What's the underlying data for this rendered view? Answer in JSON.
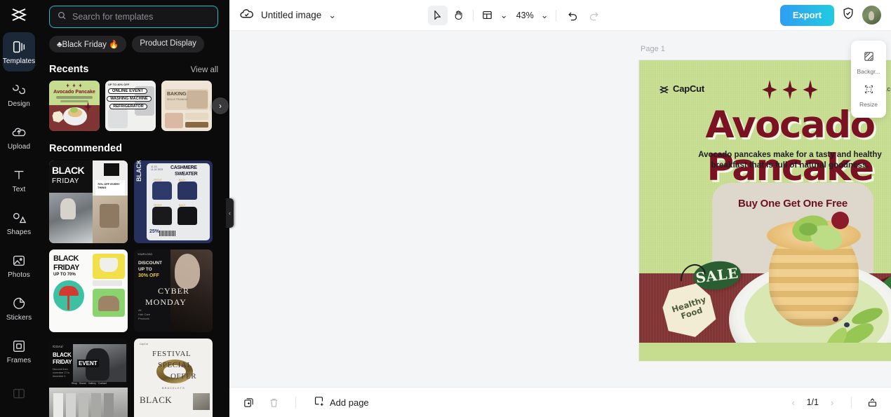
{
  "app": {
    "name": "CapCut Online Editor"
  },
  "sidebar_rail": {
    "logo_name": "capcut-logo",
    "items": [
      {
        "label": "Templates",
        "icon": "templates-icon",
        "active": true
      },
      {
        "label": "Design",
        "icon": "design-icon",
        "active": false
      },
      {
        "label": "Upload",
        "icon": "upload-cloud-icon",
        "active": false
      },
      {
        "label": "Text",
        "icon": "text-icon",
        "active": false
      },
      {
        "label": "Shapes",
        "icon": "shapes-icon",
        "active": false
      },
      {
        "label": "Photos",
        "icon": "photos-icon",
        "active": false
      },
      {
        "label": "Stickers",
        "icon": "stickers-icon",
        "active": false
      },
      {
        "label": "Frames",
        "icon": "frames-icon",
        "active": false
      }
    ]
  },
  "templates_panel": {
    "search": {
      "placeholder": "Search for templates",
      "value": "",
      "icon": "search-icon"
    },
    "chips": [
      "♣Black Friday 🔥",
      "Product Display"
    ],
    "recents": {
      "title": "Recents",
      "view_all": "View all",
      "next_arrow": "›",
      "cards": [
        {
          "name": "avocado-pancake-template",
          "title": "Avocado Pancake"
        },
        {
          "name": "online-event-template",
          "lines": [
            "UP TO 40% OFF",
            "ONLINE EVENT",
            "WASHING MACHINE",
            "REFRIGERATOR"
          ]
        },
        {
          "name": "baking-skills-template",
          "title": "BAKING",
          "sub": "SKILLS TRAINING"
        }
      ]
    },
    "recommended": {
      "title": "Recommended",
      "cards": [
        {
          "name": "black-friday-fashion-template",
          "line1": "BLACK",
          "line2": "FRIDAY",
          "badge": "70% OFF EVERY THING"
        },
        {
          "name": "cashmere-sweater-template",
          "line1": "CASHMERE",
          "line2": "SWEATER",
          "side": "BLACK FRIDAY",
          "date": "11.15-11.24 2023",
          "discount": "25%"
        },
        {
          "name": "black-friday-furniture-template",
          "line1": "BLACK",
          "line2": "FRIDAY",
          "line3": "UP TO 70%"
        },
        {
          "name": "cyber-monday-template",
          "line1": "DISCOUNT",
          "line2": "UP TO",
          "line3": "30% OFF",
          "line4": "CYBER",
          "line5": "MONDAY"
        },
        {
          "name": "black-friday-event-template",
          "line1": "BLACK",
          "line2": "FRIDAY",
          "line3": "EVENT",
          "tag": "/CGA1/"
        },
        {
          "name": "festival-special-offer-template",
          "line1": "FESTIVAL",
          "line2": "SPECIAL",
          "line3": "OFFER",
          "line4": "BLACK",
          "sub": "BRACELETS"
        }
      ]
    },
    "collapse_handle": "‹"
  },
  "topbar": {
    "cloud_icon": "cloud-saved-icon",
    "doc_title": "Untitled image",
    "title_caret": "⌄",
    "tools": [
      {
        "name": "select-tool",
        "icon": "cursor-arrow-icon",
        "selected": true
      },
      {
        "name": "hand-tool",
        "icon": "hand-icon",
        "selected": false
      },
      {
        "name": "layout-tool",
        "icon": "layout-grid-icon",
        "selected": false
      }
    ],
    "layout_caret": "⌄",
    "zoom": "43%",
    "zoom_caret": "⌄",
    "undo_icon": "undo-icon",
    "redo_icon": "redo-icon",
    "export_label": "Export",
    "shield_icon": "shield-icon",
    "avatar_name": "user-avatar"
  },
  "canvas": {
    "page_label": "Page 1",
    "poster": {
      "brand": "CapCut",
      "url": "www.capcut.com",
      "headline": "Avocado Pancake",
      "subhead": "Avocado pancakes make for a tasty and healthy breakfast that is full of natural goodness.",
      "promo": "Buy One Get One Free",
      "sale_badge": "SALE",
      "tag_line1": "Healthy",
      "tag_line2": "Food",
      "colors": {
        "background": "#c6dd90",
        "headline": "#7b1224",
        "band": "#813434",
        "sale": "#2b5d33",
        "leaf": "#2f7a34"
      }
    }
  },
  "right_tools": [
    {
      "label": "Backgr...",
      "icon": "background-icon",
      "name": "background-tool"
    },
    {
      "label": "Resize",
      "icon": "resize-icon",
      "name": "resize-tool"
    }
  ],
  "bottombar": {
    "duplicate_icon": "duplicate-page-icon",
    "delete_icon": "trash-icon",
    "add_page_label": "Add page",
    "add_page_icon": "add-page-icon",
    "prev_arrow": "‹",
    "page_indicator": "1/1",
    "next_arrow": "›",
    "panel_icon": "timeline-panel-icon"
  }
}
